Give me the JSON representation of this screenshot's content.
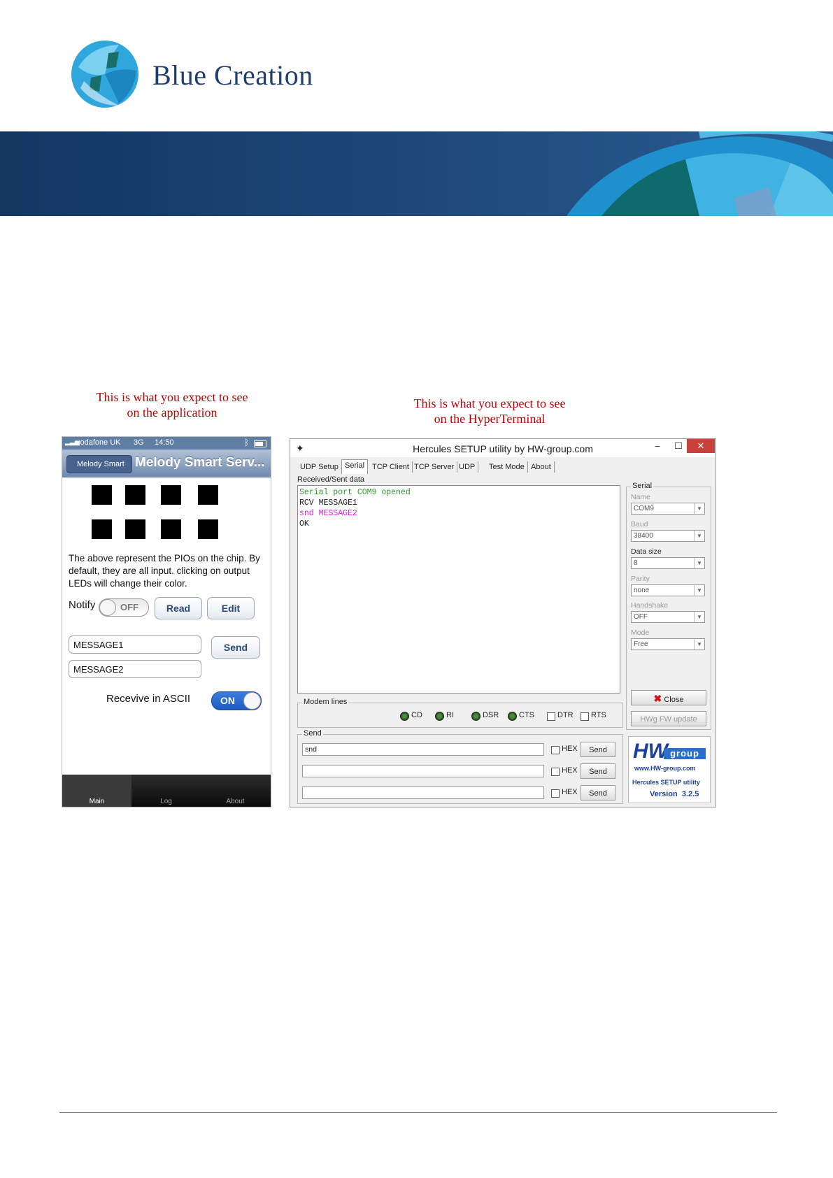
{
  "header": {
    "company_name": "Blue Creation"
  },
  "captions": {
    "app": [
      "This is what you expect to see",
      "on the application"
    ],
    "terminal": [
      "This is what you expect to see",
      "on the HyperTerminal"
    ]
  },
  "phone": {
    "status": {
      "carrier": "vodafone UK",
      "network": "3G",
      "time": "14:50"
    },
    "nav": {
      "back_label": "Melody Smart",
      "title": "Melody Smart Serv..."
    },
    "description": "The above represent the PIOs on the chip. By default, they are all input. clicking on output LEDs will change their color.",
    "notify": {
      "label": "Notify",
      "state": "OFF"
    },
    "read_button": "Read",
    "edit_button": "Edit",
    "message1": "MESSAGE1",
    "message2": "MESSAGE2",
    "send_button": "Send",
    "ascii": {
      "label": "Recevive in ASCII",
      "state": "ON"
    },
    "tabs": [
      "Main",
      "Log",
      "About"
    ]
  },
  "hercules": {
    "title": "Hercules SETUP utility by HW-group.com",
    "window_buttons": {
      "minimize": "–",
      "maximize": "☐",
      "close": "✕"
    },
    "tabs": [
      "UDP Setup",
      "Serial",
      "TCP Client",
      "TCP Server",
      "UDP",
      "Test Mode",
      "About"
    ],
    "received_label": "Received/Sent data",
    "log": [
      {
        "text": "Serial port COM9 opened",
        "color": "#2e9b2e"
      },
      {
        "text": "RCV MESSAGE1",
        "color": "#222222"
      },
      {
        "text": "snd MESSAGE2",
        "color": "#e020e0"
      },
      {
        "text": "OK",
        "color": "#222222"
      }
    ],
    "serial_panel": {
      "group_label": "Serial",
      "name_label": "Name",
      "name_value": "COM9",
      "baud_label": "Baud",
      "baud_value": "38400",
      "datasize_label": "Data size",
      "datasize_value": "8",
      "parity_label": "Parity",
      "parity_value": "none",
      "handshake_label": "Handshake",
      "handshake_value": "OFF",
      "mode_label": "Mode",
      "mode_value": "Free",
      "close_button": "Close",
      "fw_button": "HWg FW update"
    },
    "modem": {
      "label": "Modem lines",
      "leds": [
        "CD",
        "RI",
        "DSR",
        "CTS"
      ],
      "checks": [
        "DTR",
        "RTS"
      ]
    },
    "send": {
      "label": "Send",
      "rows": [
        {
          "value": "snd",
          "hex": "HEX",
          "button": "Send"
        },
        {
          "value": "",
          "hex": "HEX",
          "button": "Send"
        },
        {
          "value": "",
          "hex": "HEX",
          "button": "Send"
        }
      ]
    },
    "hw_logo": {
      "brand": "HW",
      "brand_suffix": "group",
      "url": "www.HW-group.com",
      "product": "Hercules SETUP utility",
      "version": "Version  3.2.5"
    }
  },
  "colors": {
    "brand_blue": "#1f3f6e",
    "caption_red": "#c00000",
    "banner": "#1e4a7c"
  }
}
